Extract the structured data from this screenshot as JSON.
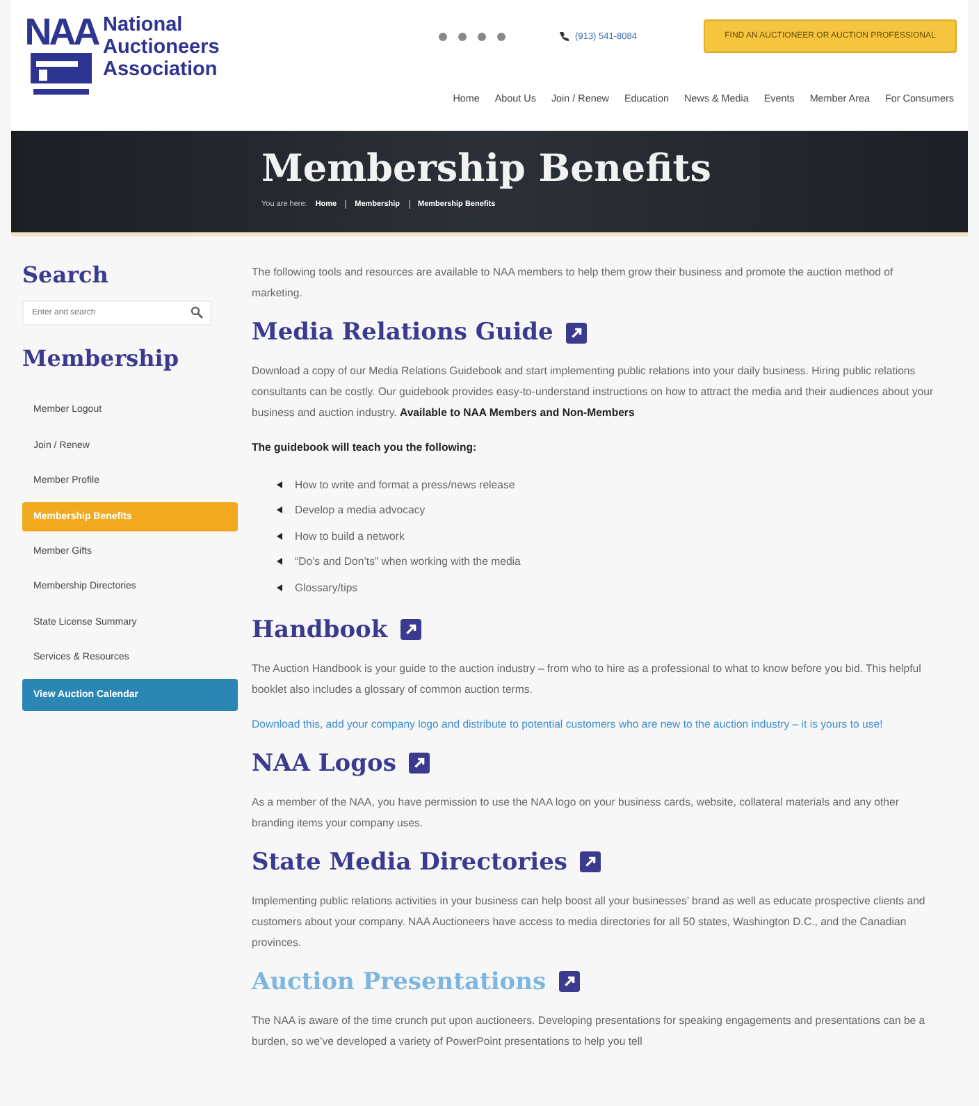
{
  "logo": {
    "mark": "NAA",
    "name_lines": [
      "National",
      "Auctioneers",
      "Association"
    ]
  },
  "header": {
    "phone": "(913) 541-8084",
    "cta": "FIND AN AUCTIONEER OR AUCTION PROFESSIONAL"
  },
  "nav": [
    "Home",
    "About Us",
    "Join / Renew",
    "Education",
    "News & Media",
    "Events",
    "Member Area",
    "For Consumers"
  ],
  "banner": {
    "title": "Membership Benefits",
    "breadcrumb_prefix": "You are here:",
    "breadcrumb": [
      "Home",
      "Membership",
      "Membership Benefits"
    ]
  },
  "sidebar": {
    "search_title": "Search",
    "search": {
      "placeholder": "Enter and search"
    },
    "section_title": "Membership",
    "items": [
      {
        "label": "Member Logout",
        "selected": false
      },
      {
        "label": "Join / Renew",
        "selected": false
      },
      {
        "label": "Member Profile",
        "selected": false
      },
      {
        "label": "Membership Benefits",
        "selected": true
      },
      {
        "label": "Member Gifts",
        "selected": false
      },
      {
        "label": "Membership Directories",
        "selected": false
      },
      {
        "label": "State License Summary",
        "selected": false
      },
      {
        "label": "Services & Resources",
        "selected": false
      }
    ],
    "button": "View Auction Calendar"
  },
  "content": {
    "intro": "The following tools and resources are available to NAA members to help them grow their business and promote the auction method of marketing.",
    "sections": [
      {
        "title": "Media Relations Guide",
        "hovered": false,
        "paragraphs": [
          {
            "kind": "text",
            "text": "Download a copy of our Media Relations Guidebook and start implementing public relations into your daily business. Hiring public relations consultants can be costly. Our guidebook provides easy-to-understand instructions on how to attract the media and their audiences about your business and auction industry. **Available to NAA Members and Non-Members**"
          },
          {
            "kind": "lead",
            "text": "The guidebook will teach you the following:"
          }
        ],
        "bullets": [
          "How to write and format a press/news release",
          "Develop a media advocacy",
          "How to build a network",
          "“Do’s and Don’ts” when working with the media",
          "Glossary/tips"
        ]
      },
      {
        "title": "Handbook",
        "hovered": false,
        "paragraphs": [
          {
            "kind": "text",
            "text": "The Auction Handbook is your guide to the auction industry – from who to hire as a professional to what to know before you bid. This helpful booklet also includes a glossary of common auction terms."
          },
          {
            "kind": "link",
            "text": "Download this, add your company logo and distribute to potential customers who are new to the auction industry – it is yours to use!"
          }
        ]
      },
      {
        "title": "NAA Logos",
        "hovered": false,
        "paragraphs": [
          {
            "kind": "text",
            "text": "As a member of the NAA, you have permission to use the NAA logo on your business cards, website, collateral materials and any other branding items your company uses."
          }
        ]
      },
      {
        "title": "State Media Directories",
        "hovered": false,
        "paragraphs": [
          {
            "kind": "text",
            "text": "Implementing public relations activities in your business can help boost all your businesses’ brand as well as educate prospective clients and customers about your company. NAA Auctioneers have access to media directories for all 50 states, Washington D.C., and the Canadian provinces."
          }
        ]
      },
      {
        "title": "Auction Presentations",
        "hovered": true,
        "paragraphs": [
          {
            "kind": "text",
            "text": "The NAA is aware of the time crunch put upon auctioneers. Developing presentations for speaking engagements and presentations can be a burden, so we’ve developed a variety of PowerPoint presentations to help you tell"
          }
        ]
      }
    ]
  }
}
